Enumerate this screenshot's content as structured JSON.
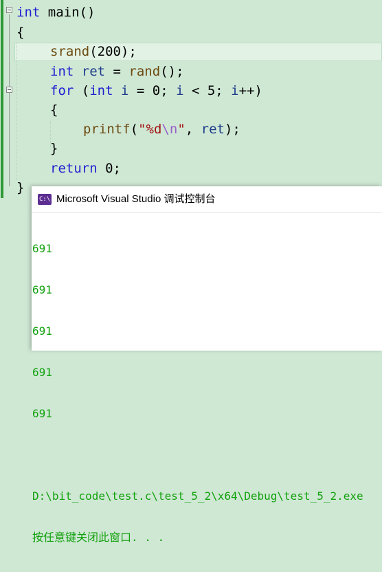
{
  "editor": {
    "lines": {
      "l1_kw": "int",
      "l1_rest": " main()",
      "l2": "{",
      "l3_fn": "srand",
      "l3_rest": "(200);",
      "l4_kw": "int",
      "l4_var": " ret",
      "l4_eq": " = ",
      "l4_fn": "rand",
      "l4_rest": "();",
      "l5_for": "for",
      "l5_p": " (",
      "l5_int": "int",
      "l5_i": " i",
      "l5_a": " = 0; ",
      "l5_i2": "i",
      "l5_b": " < 5; ",
      "l5_i3": "i",
      "l5_c": "++)",
      "l6": "{",
      "l7_fn": "printf",
      "l7_p": "(",
      "l7_s1": "\"%d",
      "l7_esc": "\\n",
      "l7_s2": "\"",
      "l7_comma": ", ",
      "l7_var": "ret",
      "l7_end": ");",
      "l8": "}",
      "l9_kw": "return",
      "l9_rest": " 0;",
      "l10": "}"
    }
  },
  "console": {
    "title": "Microsoft Visual Studio 调试控制台",
    "icon": "console-app-icon",
    "output": [
      "691",
      "691",
      "691",
      "691",
      "691",
      "",
      "D:\\bit_code\\test.c\\test_5_2\\x64\\Debug\\test_5_2.exe",
      "按任意键关闭此窗口. . ."
    ],
    "text_color": "#13a10e"
  }
}
